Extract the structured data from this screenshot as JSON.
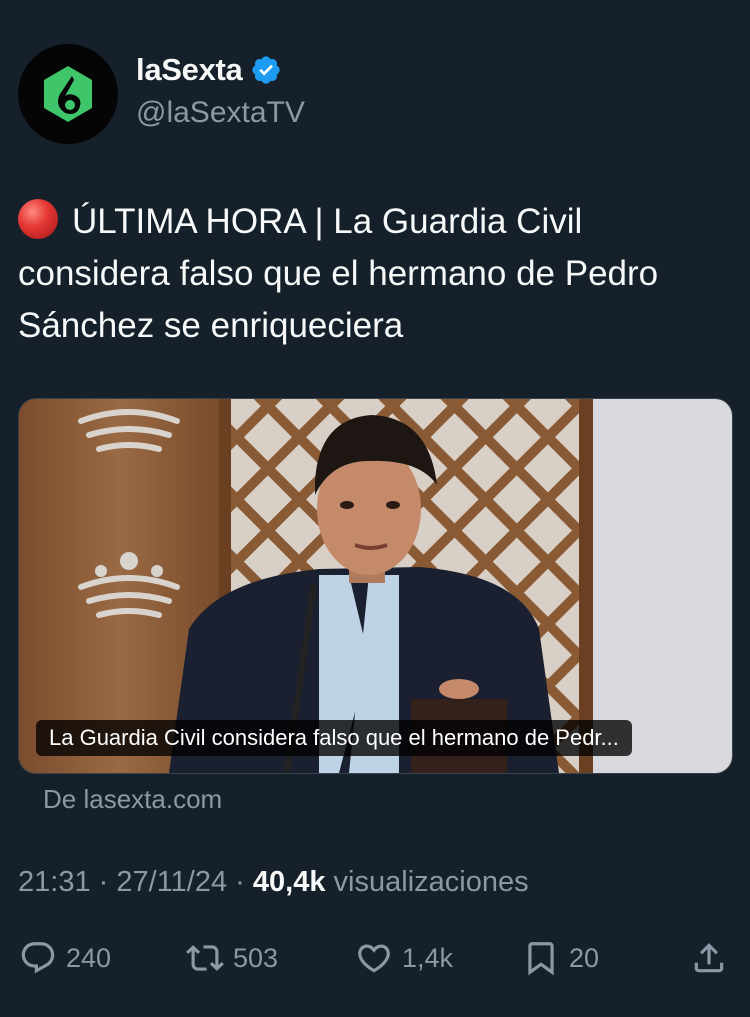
{
  "account": {
    "display_name": "laSexta",
    "handle": "@laSextaTV",
    "avatar_glyph": "6",
    "avatar_icon": "lasexta-logo-icon",
    "verified_icon": "verified-badge-icon",
    "brand_green": "#3fc56a",
    "verified_blue": "#1d9bf0"
  },
  "tweet": {
    "live_icon": "red-circle-icon",
    "text": "ÚLTIMA HORA | La Guardia Civil considera falso que el hermano de Pedro Sánchez se enriqueciera"
  },
  "media": {
    "caption": "La Guardia Civil considera falso que el hermano de Pedr...",
    "source": "De lasexta.com"
  },
  "meta": {
    "time": "21:31",
    "separator": "·",
    "date": "27/11/24",
    "views_count": "40,4k",
    "views_label": "visualizaciones"
  },
  "actions": {
    "replies": {
      "icon": "reply-icon",
      "count": "240"
    },
    "reposts": {
      "icon": "repost-icon",
      "count": "503"
    },
    "likes": {
      "icon": "heart-icon",
      "count": "1,4k"
    },
    "bookmarks": {
      "icon": "bookmark-icon",
      "count": "20"
    },
    "share": {
      "icon": "share-icon"
    }
  },
  "colors": {
    "background": "#15202b",
    "text_primary": "#f7f9f9",
    "text_secondary": "#8b98a5",
    "live_red": "#e53935"
  }
}
